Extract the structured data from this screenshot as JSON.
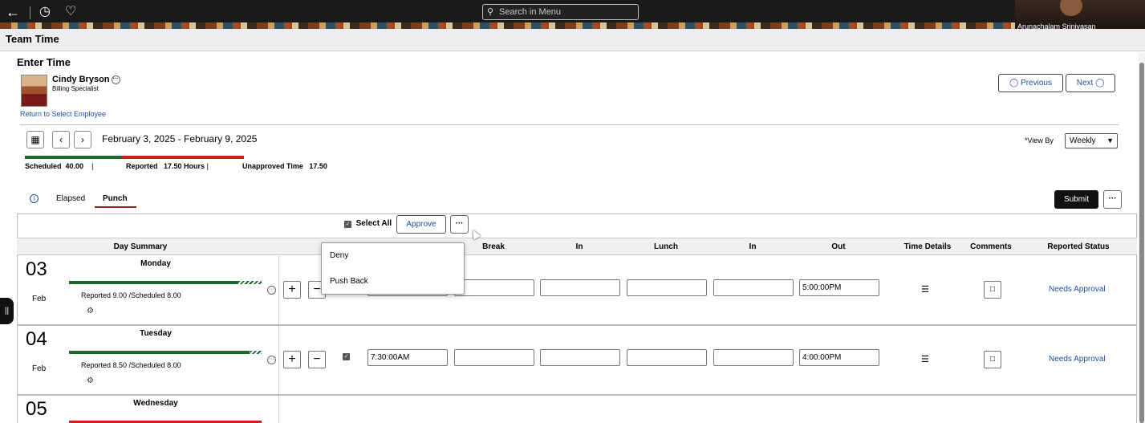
{
  "topbar": {
    "back_icon": "arrow-left-icon",
    "history_icon": "clock-icon",
    "favorites_icon": "heart-icon",
    "search_placeholder": "Search in Menu",
    "user_name": "Arunachalam Srinivasan"
  },
  "page": {
    "title": "Team Time",
    "section": "Enter Time"
  },
  "employee": {
    "name": "Cindy Bryson",
    "title": "Billing Specialist",
    "return_link": "Return to Select Employee"
  },
  "nav": {
    "previous": "Previous",
    "next": "Next"
  },
  "period": {
    "date_range": "February 3, 2025 - February 9, 2025",
    "scheduled_label": "Scheduled",
    "scheduled_value": "40.00",
    "reported_label": "Reported",
    "reported_value": "17.50 Hours",
    "unapproved_label": "Unapproved Time",
    "unapproved_value": "17.50",
    "view_by_label": "*View By",
    "view_by_value": "Weekly"
  },
  "tabs": [
    {
      "label": "Elapsed"
    },
    {
      "label": "Punch"
    }
  ],
  "actions": {
    "submit": "Submit",
    "select_all": "Select All",
    "approve": "Approve",
    "more": "···"
  },
  "dropdown": {
    "items": [
      "Deny",
      "Push Back"
    ]
  },
  "columns": [
    "Day Summary",
    "Break",
    "In",
    "Lunch",
    "In",
    "Out",
    "Time Details",
    "Comments",
    "Reported Status"
  ],
  "days": [
    {
      "num": "03",
      "mon": "Feb",
      "name": "Monday",
      "reported": "Reported 9.00 /Scheduled 8.00",
      "in": "",
      "break": "",
      "in2": "",
      "lunch": "",
      "out": "5:00:00PM",
      "status": "Needs Approval",
      "progress": 0.88,
      "bar_color": "#1a6b2a"
    },
    {
      "num": "04",
      "mon": "Feb",
      "name": "Tuesday",
      "reported": "Reported 8.50 /Scheduled 8.00",
      "in": "7:30:00AM",
      "break": "",
      "in2": "",
      "lunch": "",
      "out": "4:00:00PM",
      "status": "Needs Approval",
      "progress": 0.94,
      "bar_color": "#1a6b2a"
    },
    {
      "num": "05",
      "mon": "",
      "name": "Wednesday",
      "reported": "",
      "in": "",
      "break": "",
      "in2": "",
      "lunch": "",
      "out": "",
      "status": "",
      "progress": 1.0,
      "bar_color": "#cc1f1f"
    }
  ],
  "colors": {
    "accent": "#1f4e9a",
    "green": "#1a6b2a",
    "red": "#cc1f1f",
    "tab_underline": "#8b2a1a"
  }
}
